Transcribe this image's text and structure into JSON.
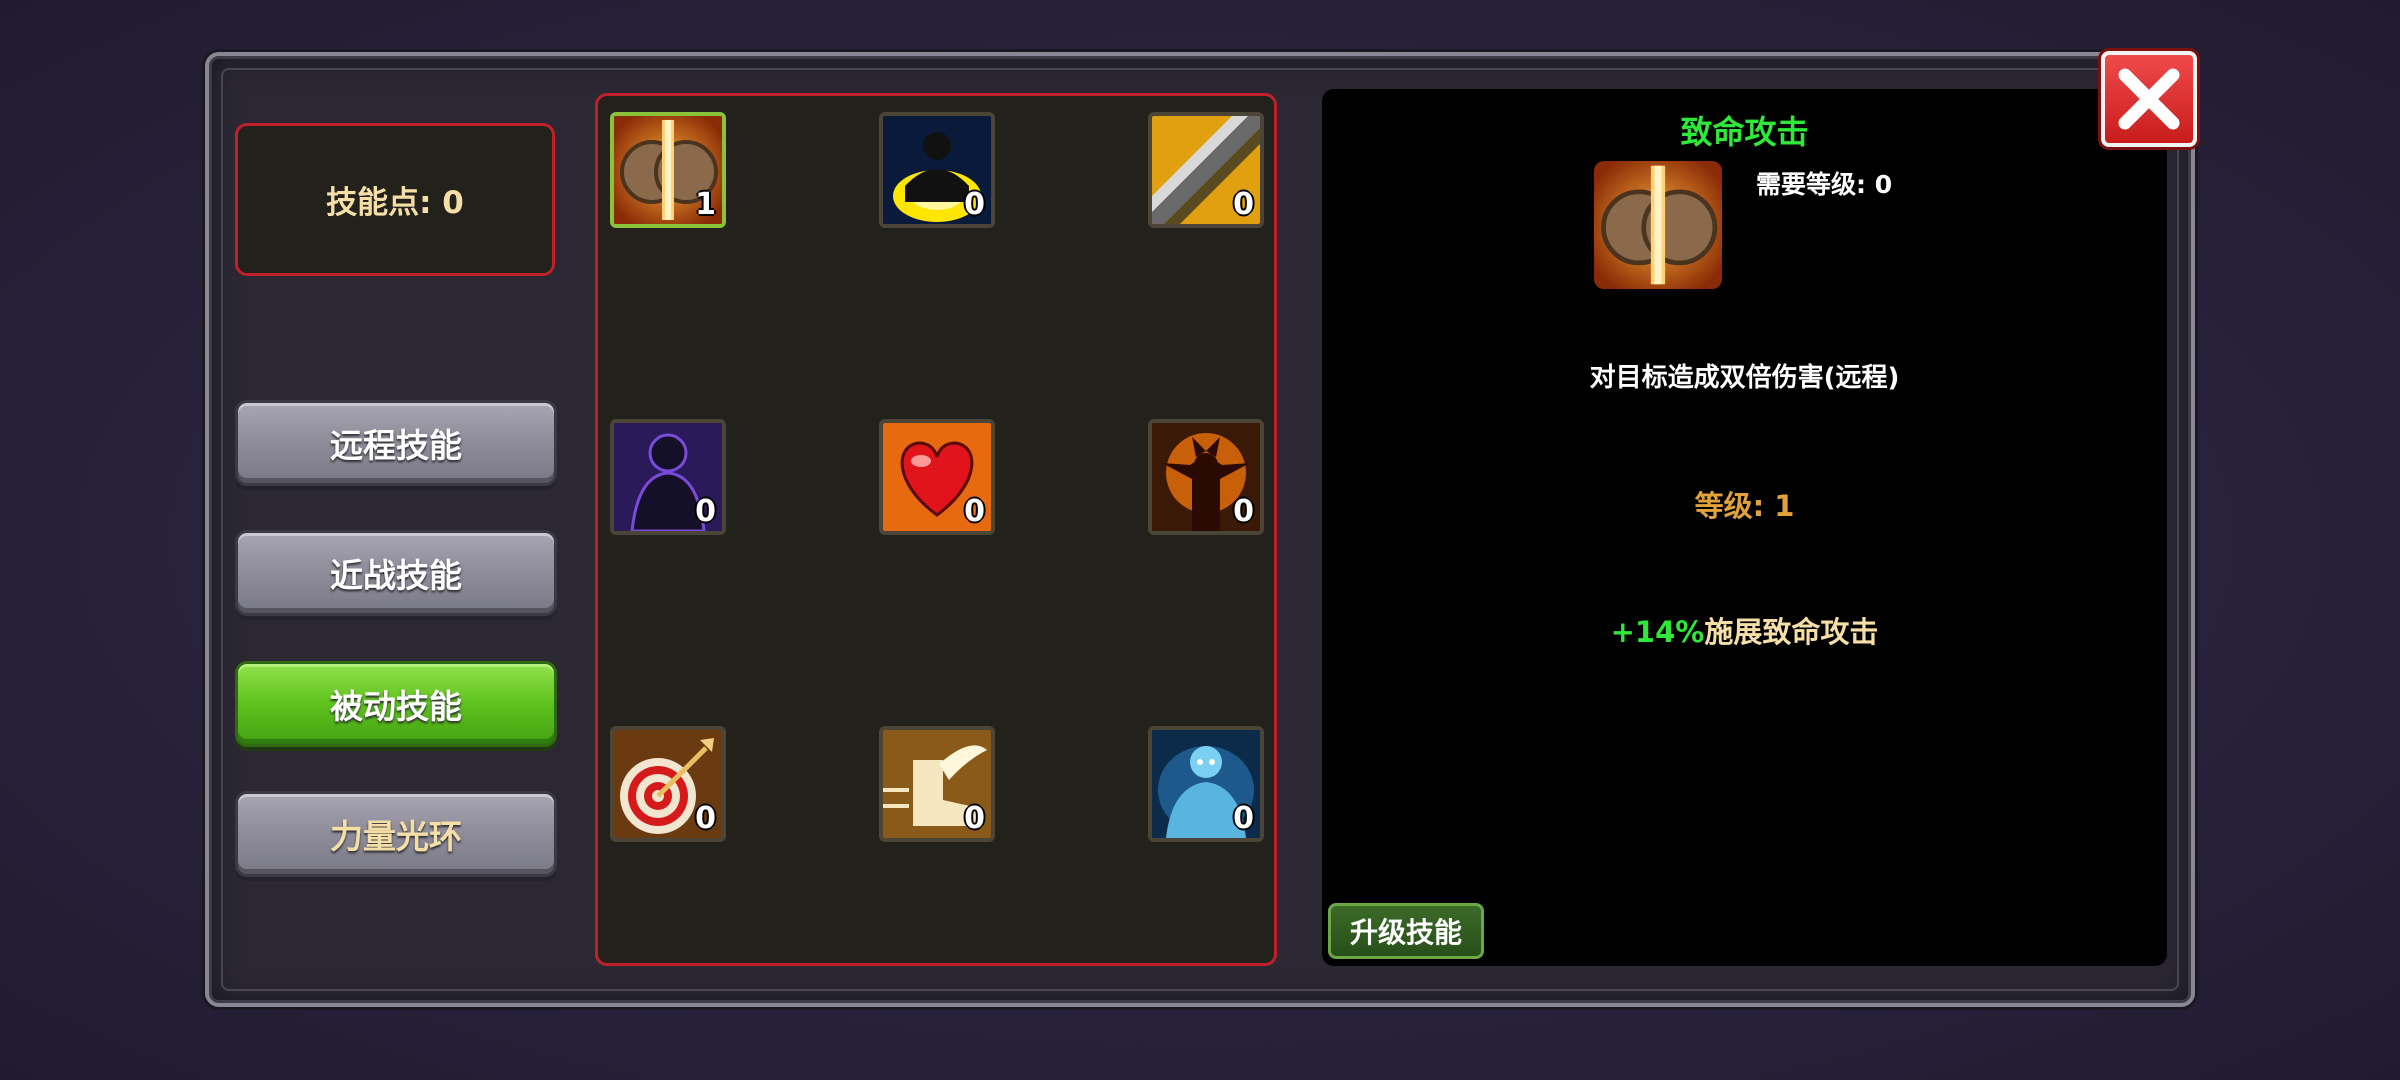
{
  "skill_points": {
    "label": "技能点: 0"
  },
  "tabs": [
    {
      "label": "远程技能",
      "active": false
    },
    {
      "label": "近战技能",
      "active": false
    },
    {
      "label": "被动技能",
      "active": true
    },
    {
      "label": "力量光环",
      "active": false
    }
  ],
  "skills": [
    {
      "icon": "shield-sword-icon",
      "level": "1",
      "selected": true
    },
    {
      "icon": "glowing-warrior-icon",
      "level": "0"
    },
    {
      "icon": "golden-blade-icon",
      "level": "0"
    },
    {
      "icon": "shadow-figure-icon",
      "level": "0"
    },
    {
      "icon": "heart-icon",
      "level": "0"
    },
    {
      "icon": "demon-rage-icon",
      "level": "0"
    },
    {
      "icon": "target-dart-icon",
      "level": "0"
    },
    {
      "icon": "winged-boot-icon",
      "level": "0"
    },
    {
      "icon": "ice-spirit-icon",
      "level": "0"
    }
  ],
  "detail": {
    "title": "致命攻击",
    "icon": "shield-sword-icon",
    "required_level": "需要等级: 0",
    "description": "对目标造成双倍伤害(远程)",
    "level": "等级: 1",
    "effect_value": "+14%",
    "effect_text": "施展致命攻击"
  },
  "upgrade_button": {
    "label": "升级技能"
  },
  "colors": {
    "active_tab": "#5fc21e",
    "panel_border": "#c0202a",
    "title_green": "#2fe83a",
    "level_gold": "#e2a23a",
    "close_red": "#d92a2a"
  }
}
